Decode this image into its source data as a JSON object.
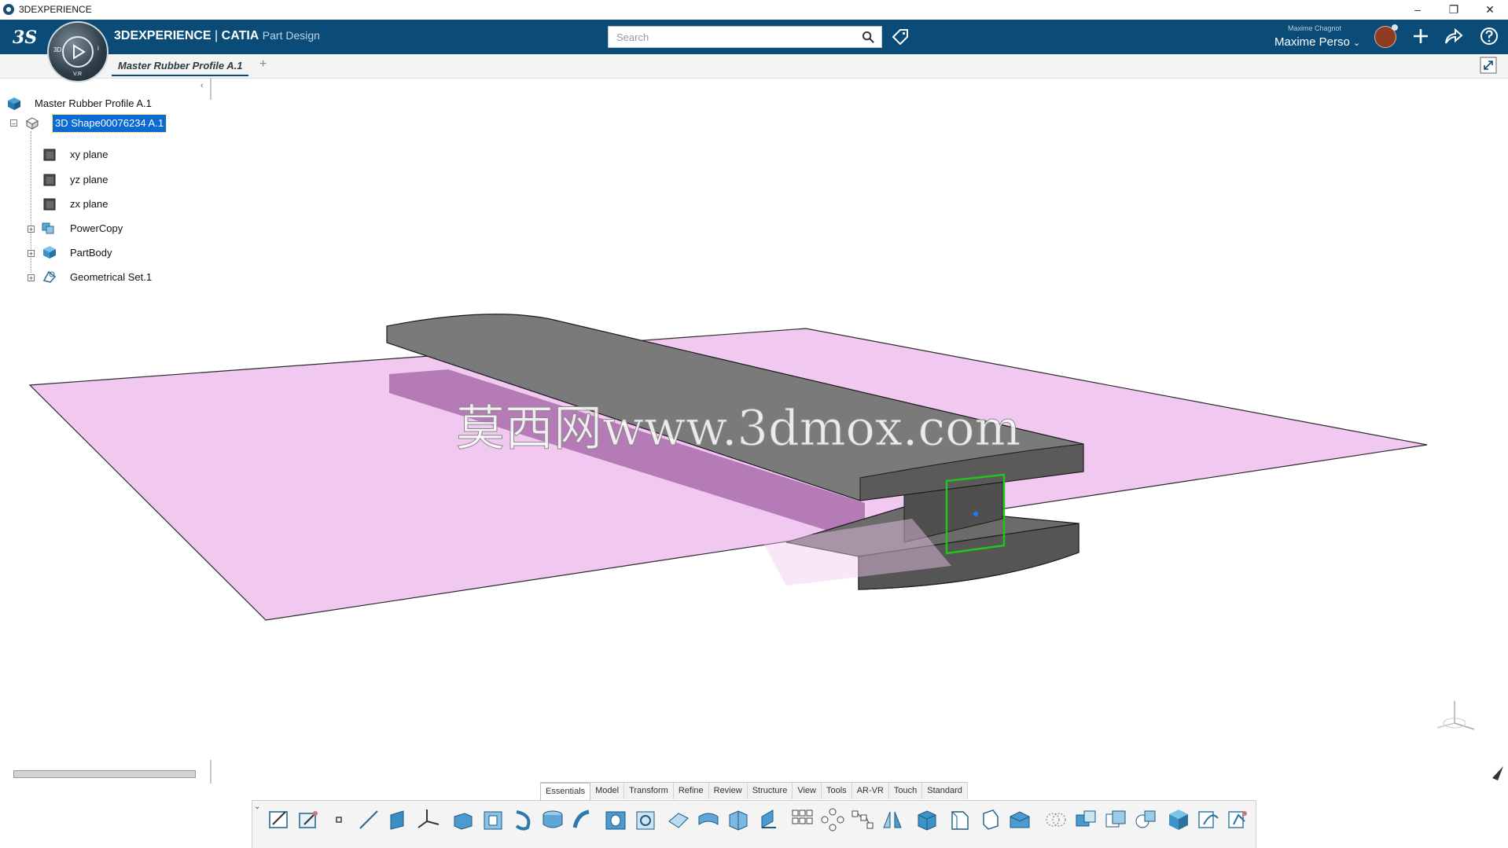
{
  "window": {
    "title": "3DEXPERIENCE"
  },
  "header": {
    "brand_main": "3DEXPERIENCE",
    "brand_sep": " | ",
    "brand_product": "CATIA",
    "brand_app": "Part Design",
    "search_placeholder": "Search",
    "user_small": "Maxime Chagnot",
    "user_name": "Maxime Perso"
  },
  "tabs": [
    {
      "label": "Master Rubber Profile A.1"
    }
  ],
  "tree": {
    "root": "Master Rubber Profile A.1",
    "shape": "3D Shape00076234 A.1",
    "children": [
      "xy plane",
      "yz plane",
      "zx plane",
      "PowerCopy",
      "PartBody",
      "Geometrical Set.1"
    ]
  },
  "watermark": "莫西网www.3dmox.com",
  "section_tabs": [
    "Essentials",
    "Model",
    "Transform",
    "Refine",
    "Review",
    "Structure",
    "View",
    "Tools",
    "AR-VR",
    "Touch",
    "Standard"
  ],
  "colors": {
    "header_bg": "#0a4c77",
    "plane_fill": "#f1c8f0",
    "plane_edge": "#222222",
    "solid_top": "#777777",
    "solid_side": "#555555",
    "selection_green": "#22c41c",
    "tree_selection": "#0a6ad6"
  }
}
